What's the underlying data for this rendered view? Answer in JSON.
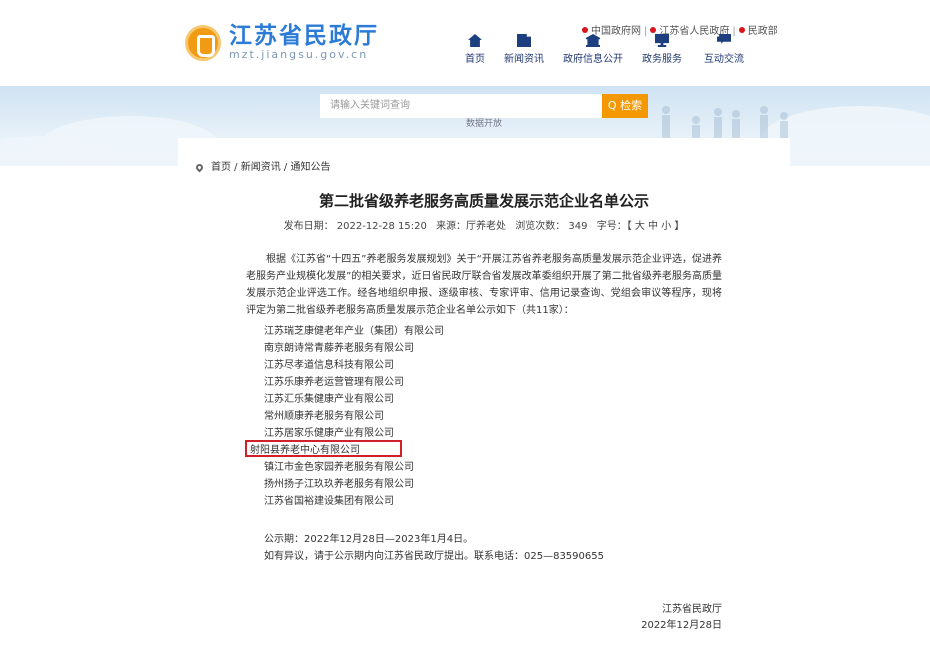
{
  "header": {
    "site_title": "江苏省民政厅",
    "site_url": "mzt.jiangsu.gov.cn",
    "top_links": [
      "中国政府网",
      "江苏省人民政府",
      "民政部"
    ],
    "nav": [
      {
        "label": "首页",
        "icon": "home-icon"
      },
      {
        "label": "新闻资讯",
        "icon": "news-icon"
      },
      {
        "label": "政府信息公开",
        "icon": "government-building-icon"
      },
      {
        "label": "政务服务",
        "icon": "service-monitor-icon"
      },
      {
        "label": "互动交流",
        "icon": "chat-icon"
      }
    ]
  },
  "search": {
    "placeholder": "请输入关键词查询",
    "button_label": "Q 检索",
    "sub_label": "数据开放"
  },
  "breadcrumb": "首页 / 新闻资讯 / 通知公告",
  "article": {
    "title": "第二批省级养老服务高质量发展示范企业名单公示",
    "date": "发布日期： 2022-12-28 15:20",
    "source": "来源：厅养老处",
    "views": "浏览次数： 349",
    "font_size": "字号：【 大 中 小 】",
    "intro": "根据《江苏省“十四五”养老服务发展规划》关于“开展江苏省养老服务高质量发展示范企业评选，促进养老服务产业规模化发展”的相关要求，近日省民政厅联合省发展改革委组织开展了第二批省级养老服务高质量发展示范企业评选工作。经各地组织申报、逐级审核、专家评审、信用记录查询、党组会审议等程序，现将评定为第二批省级养老服务高质量发展示范企业名单公示如下（共11家）：",
    "companies": [
      "江苏瑞芝康健老年产业（集团）有限公司",
      "南京朗诗常青藤养老服务有限公司",
      "江苏尽孝道信息科技有限公司",
      "江苏乐康养老运营管理有限公司",
      "江苏汇乐集健康产业有限公司",
      "常州顺康养老服务有限公司",
      "江苏居家乐健康产业有限公司",
      "射阳县养老中心有限公司",
      "镇江市金色家园养老服务有限公司",
      "扬州扬子江玖玖养老服务有限公司",
      "江苏省国裕建设集团有限公司"
    ],
    "highlighted_company": "射阳县养老中心有限公司",
    "period": "公示期：2022年12月28日—2023年1月4日。",
    "objection": "如有异议，请于公示期内向江苏省民政厅提出。联系电话：025—83590655",
    "signature_org": "江苏省民政厅",
    "signature_date": "2022年12月28日"
  },
  "colors": {
    "title_blue": "#2c7bd6",
    "nav_blue": "#223a73",
    "search_orange": "#f39800",
    "highlight_red": "#d0212a"
  }
}
